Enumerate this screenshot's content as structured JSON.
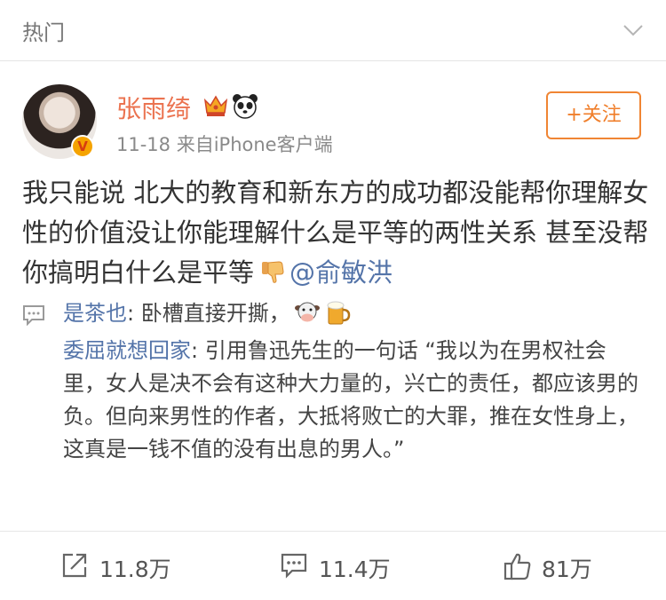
{
  "header": {
    "title": "热门"
  },
  "post": {
    "username": "张雨绮",
    "meta": "11-18  来自iPhone客户端",
    "follow_label": "+关注",
    "text_part1": "我只能说 北大的教育和新东方的成功都没能帮你理解女性的价值没让你能理解什么是平等的两性关系 甚至没帮你搞明白什么是平等",
    "mention": "@俞敏洪"
  },
  "comments": [
    {
      "user": "是茶也",
      "sep": ": ",
      "text": "卧槽直接开撕，"
    },
    {
      "user": "委屈就想回家",
      "sep": ": ",
      "text": "引用鲁迅先生的一句话 “我以为在男权社会里，女人是决不会有这种大力量的，兴亡的责任，都应该男的负。但向来男性的作者，大抵将败亡的大罪，推在女性身上，这真是一钱不值的没有出息的男人。”"
    }
  ],
  "footer": {
    "repost_count": "11.8万",
    "comment_count": "11.4万",
    "like_count": "81万"
  },
  "icons": {
    "header_chevron": "chevron-down-icon",
    "verified": "verified-badge-icon",
    "crown": "crown-icon",
    "panda": "panda-icon",
    "thumbs_down": "thumbs-down-emoji",
    "cow": "cow-emoji",
    "beer": "beer-emoji",
    "comment": "comment-icon",
    "repost": "repost-icon",
    "like": "like-icon"
  },
  "colors": {
    "accent": "#eb7350",
    "link": "#5474a9",
    "follow_border": "#f08533"
  }
}
